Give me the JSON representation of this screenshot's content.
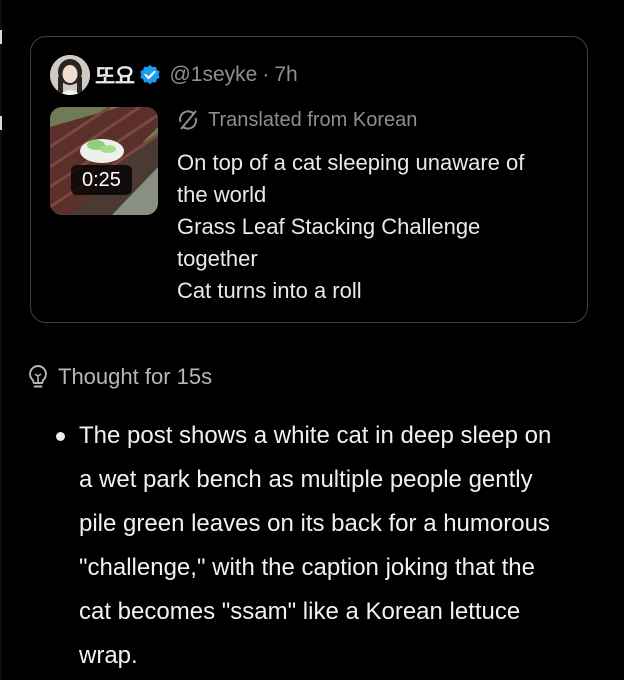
{
  "tweet": {
    "display_name": "또요",
    "handle": "@1seyke",
    "separator": "·",
    "time": "7h",
    "video_duration": "0:25",
    "translated_label": "Translated from Korean",
    "text_lines": [
      "On top of a cat sleeping unaware of",
      "the world",
      "Grass Leaf Stacking Challenge",
      "together",
      "Cat turns into a roll"
    ]
  },
  "thought": {
    "label": "Thought for 15s"
  },
  "answer": {
    "lines": [
      "The post shows a white cat in deep sleep on",
      "a wet park bench as multiple people gently",
      "pile green leaves on its back for a humorous",
      "\"challenge,\" with the caption joking that the",
      "cat becomes \"ssam\" like a Korean lettuce",
      "wrap."
    ]
  },
  "colors": {
    "background": "#000000",
    "card_border": "#3e4144",
    "text_primary": "#e7e9ea",
    "text_secondary": "#8b9096",
    "verified_blue": "#1d9bf0"
  },
  "icons": {
    "verified": "verified-badge-icon",
    "translate": "translate-icon",
    "thought": "lightbulb-icon"
  }
}
